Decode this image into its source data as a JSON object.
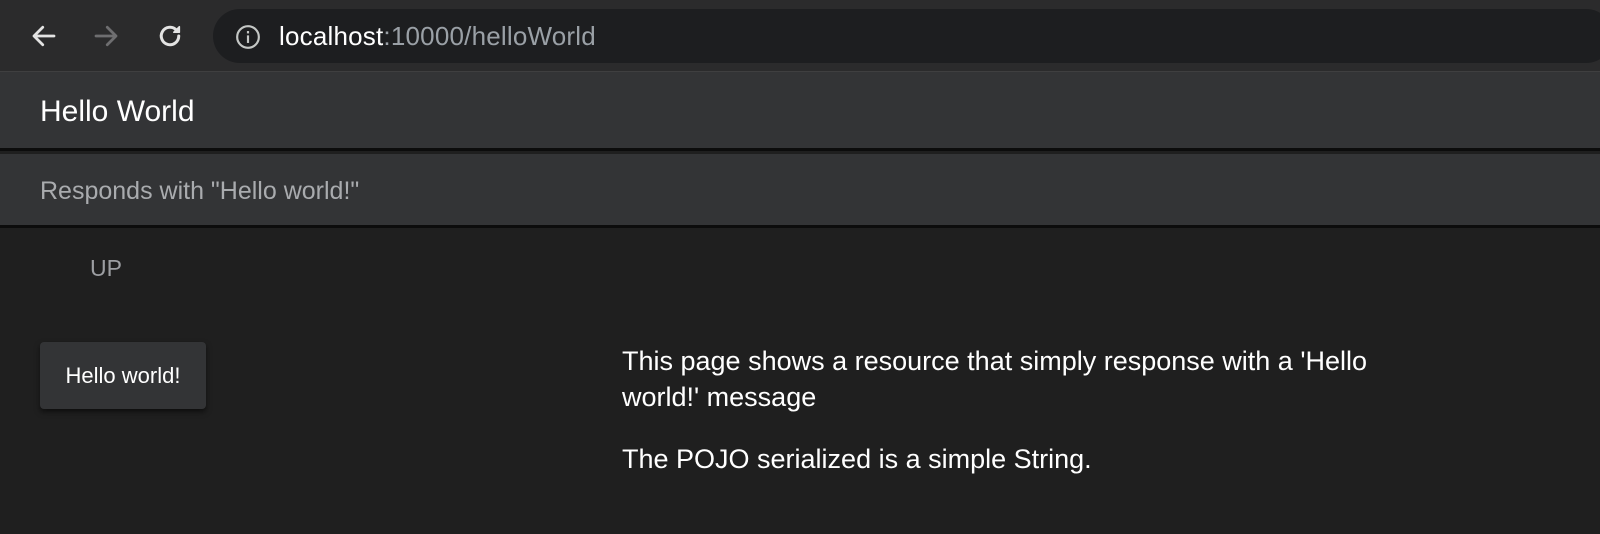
{
  "browser": {
    "back_icon": "arrow-left-icon",
    "forward_icon": "arrow-right-icon",
    "reload_icon": "reload-icon",
    "info_icon": "info-icon",
    "url_host": "localhost",
    "url_rest": ":10000/helloWorld"
  },
  "app_bar": {
    "title": "Hello World"
  },
  "subheader": {
    "text": "Responds with \"Hello world!\""
  },
  "content": {
    "status": "UP",
    "button_label": "Hello world!",
    "description": [
      "This page shows a resource that simply response with a 'Hello world!' message",
      "The POJO serialized is a simple String."
    ]
  },
  "colors": {
    "toolbar_bg": "#2b2b2c",
    "omnibox_bg": "#1d1e20",
    "app_bar_bg": "#333436",
    "content_bg": "#1f1f1f",
    "muted_text": "#9c9ea2"
  }
}
